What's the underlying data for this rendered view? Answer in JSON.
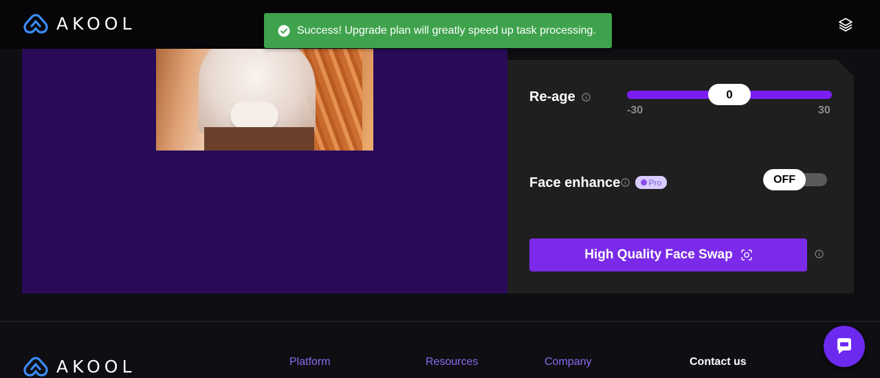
{
  "header": {
    "brand": "AKOOL",
    "layers_icon": "layers-icon"
  },
  "toast": {
    "icon": "check-circle-icon",
    "message": "Success! Upgrade plan will greatly speed up task processing."
  },
  "settings": {
    "reage": {
      "label": "Re-age",
      "value": "0",
      "min": "-30",
      "max": "30"
    },
    "face_enhance": {
      "label": "Face enhance",
      "badge": "Pro",
      "toggle_state": "OFF"
    },
    "swap_button": {
      "label": "High Quality Face Swap",
      "icon": "face-scan-icon"
    }
  },
  "footer": {
    "brand": "AKOOL",
    "links": [
      "Platform",
      "Resources",
      "Company"
    ],
    "contact": "Contact us"
  },
  "colors": {
    "accent": "#7a2ae8",
    "preview_bg": "#290a58",
    "toast_bg": "#3fa34d",
    "panel_bg": "#1f1f1f"
  }
}
